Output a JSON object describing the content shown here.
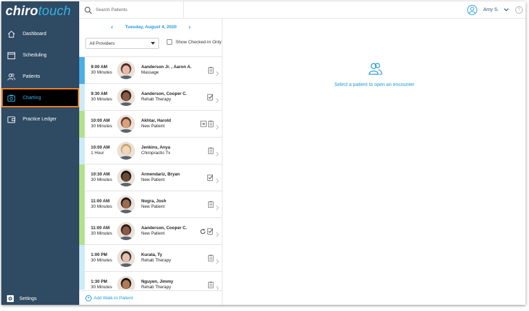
{
  "brand": {
    "part1": "chiro",
    "part2": "touch"
  },
  "sidebar": {
    "items": [
      {
        "label": "Dashboard",
        "icon": "home-icon",
        "active": false
      },
      {
        "label": "Scheduling",
        "icon": "calendar-icon",
        "active": false
      },
      {
        "label": "Patients",
        "icon": "users-icon",
        "active": false
      },
      {
        "label": "Charting",
        "icon": "camera-icon",
        "active": true
      },
      {
        "label": "Practice Ledger",
        "icon": "wallet-icon",
        "active": false
      }
    ],
    "settings_label": "Settings"
  },
  "search": {
    "placeholder": "Search Patients"
  },
  "user": {
    "name": "Amy S.",
    "help": "?"
  },
  "schedule": {
    "date": "Tuesday, August 4, 2020",
    "provider": "All Providers",
    "checked_in_label": "Show Checked-In Only",
    "appointments": [
      {
        "time": "9:00 AM",
        "duration": "30 Minutes",
        "name": "Aanderson Jr. , Aaron A.",
        "type": "Massage",
        "strip": "#49aee6",
        "status": [
          "clipboard"
        ]
      },
      {
        "time": "9:30 AM",
        "duration": "30 Minutes",
        "name": "Aanderson, Cooper C.",
        "type": "Rehab Therapy",
        "strip": "#cdeaf7",
        "status": [
          "check"
        ]
      },
      {
        "time": "10:00 AM",
        "duration": "30 Minutes",
        "name": "Akhtar, Harold",
        "type": "New Patient",
        "strip": "#b5e08a",
        "status": [
          "login",
          "clipboard"
        ]
      },
      {
        "time": "10:00 AM",
        "duration": "1 Hour",
        "name": "Jenkins, Anya",
        "type": "Chiropractic Tx",
        "strip": "#cdeaf7",
        "status": [
          "clipboard"
        ]
      },
      {
        "time": "10:30 AM",
        "duration": "30 Minutes",
        "name": "Armendariz, Bryan",
        "type": "New Patient",
        "strip": "#b5e08a",
        "status": [
          "check"
        ]
      },
      {
        "time": "11:00 AM",
        "duration": "30 Minutes",
        "name": "Nogra, Josh",
        "type": "New Patient",
        "strip": "#b5e08a",
        "status": [
          "clipboard"
        ]
      },
      {
        "time": "11:00 AM",
        "duration": "30 Minutes",
        "name": "Aanderson, Cooper C.",
        "type": "New Patient",
        "strip": "#b5e08a",
        "status": [
          "sync",
          "check"
        ]
      },
      {
        "time": "1:00 PM",
        "duration": "30 Minutes",
        "name": "Kurata, Ty",
        "type": "Rehab Therapy",
        "strip": "#cdeaf7",
        "status": [
          "clipboard"
        ]
      },
      {
        "time": "1:30 PM",
        "duration": "30 Minutes",
        "name": "Nguyen, Jimmy",
        "type": "Rehab Therapy",
        "strip": "#cdeaf7",
        "status": [
          "clipboard"
        ]
      }
    ],
    "walkin_label": "Add Walk-In Patient"
  },
  "encounter": {
    "message": "Select a patient to open an encounter"
  },
  "colors": {
    "sidebar": "#2f4a63",
    "accent": "#1f9ad6",
    "active_border": "#f07f24"
  }
}
